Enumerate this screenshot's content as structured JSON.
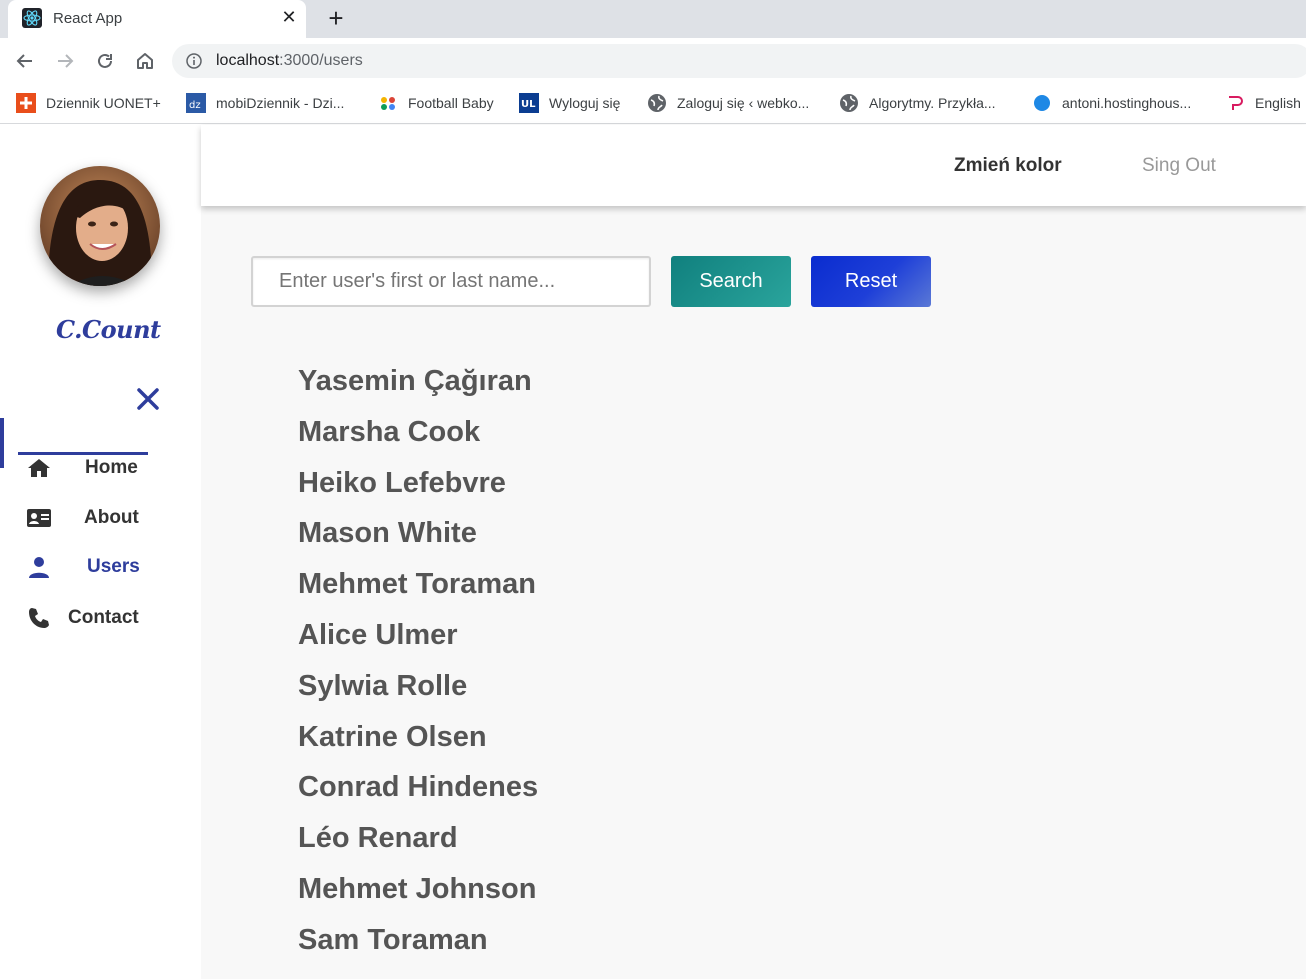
{
  "browser": {
    "tab_title": "React App",
    "tab_close_symbol": "✕",
    "new_tab_symbol": "+",
    "url_host": "localhost",
    "url_path": ":3000/users",
    "bookmarks": [
      {
        "label": "Dziennik UONET+",
        "icon": "uonet-icon"
      },
      {
        "label": "mobiDziennik - Dzi...",
        "icon": "mobidziennik-icon"
      },
      {
        "label": "Football Baby",
        "icon": "football-baby-icon"
      },
      {
        "label": "Wyloguj się",
        "icon": "ul-icon"
      },
      {
        "label": "Zaloguj się ‹ webko...",
        "icon": "globe-icon"
      },
      {
        "label": "Algorytmy. Przykła...",
        "icon": "globe-icon"
      },
      {
        "label": "antoni.hostinghous...",
        "icon": "hosting-icon"
      },
      {
        "label": "English",
        "icon": "english-icon"
      }
    ]
  },
  "sidebar": {
    "brand": "C.Count",
    "nav": [
      {
        "label": "Home",
        "icon": "home-icon",
        "active": false
      },
      {
        "label": "About",
        "icon": "id-card-icon",
        "active": false
      },
      {
        "label": "Users",
        "icon": "user-icon",
        "active": true
      },
      {
        "label": "Contact",
        "icon": "phone-icon",
        "active": false
      }
    ],
    "accent_color": "#2e3d9c"
  },
  "header": {
    "change_color": "Zmień kolor",
    "sign_out": "Sing Out"
  },
  "search": {
    "placeholder": "Enter user's first or last name...",
    "value": "",
    "search_label": "Search",
    "reset_label": "Reset"
  },
  "users": [
    "Yasemin Çağıran",
    "Marsha Cook",
    "Heiko Lefebvre",
    "Mason White",
    "Mehmet Toraman",
    "Alice Ulmer",
    "Sylwia Rolle",
    "Katrine Olsen",
    "Conrad Hindenes",
    "Léo Renard",
    "Mehmet Johnson",
    "Sam Toraman"
  ]
}
